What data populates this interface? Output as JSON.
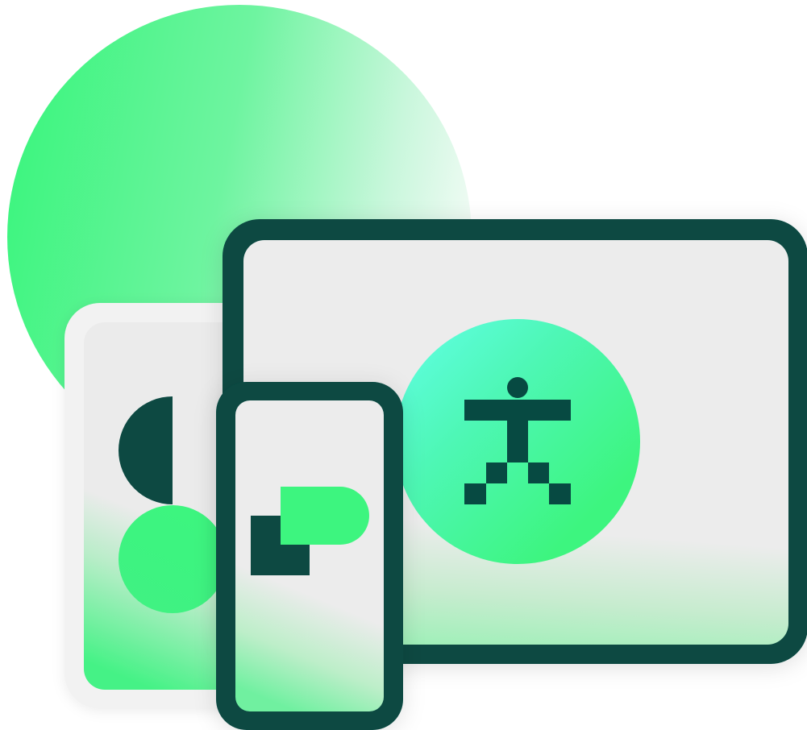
{
  "illustration": {
    "theme": "device-accessibility",
    "colors": {
      "dark_teal": "#074a42",
      "bright_green": "#3df57f",
      "mint": "#62ffe0",
      "pale_gray": "#ececec",
      "light_gray": "#f2f2f2"
    },
    "elements": [
      "decorative-circle",
      "back-phone-frame",
      "tablet-frame",
      "accessibility-figure-icon",
      "front-phone-frame",
      "d-shape-icon"
    ]
  }
}
